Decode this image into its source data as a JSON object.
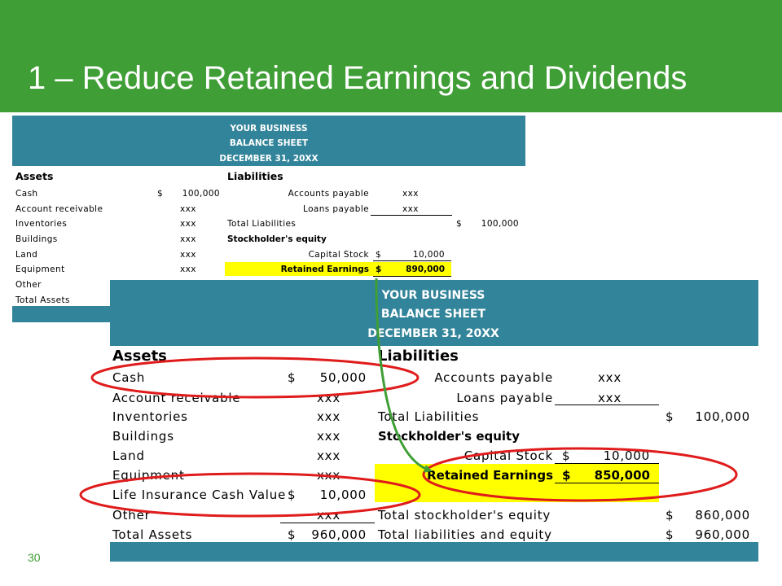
{
  "slide": {
    "title": "1 – Reduce Retained Earnings and Dividends",
    "number": "30"
  },
  "before_sheet": {
    "header": [
      "YOUR BUSINESS",
      "BALANCE SHEET",
      "DECEMBER 31, 20XX"
    ],
    "assets_heading": "Assets",
    "liabilities_heading": "Liabilities",
    "dollar": "$",
    "assets": [
      {
        "label": "Cash",
        "amount": "100,000"
      },
      {
        "label": "Account receivable",
        "amount": "xxx"
      },
      {
        "label": "Inventories",
        "amount": "xxx"
      },
      {
        "label": "Buildings",
        "amount": "xxx"
      },
      {
        "label": "Land",
        "amount": "xxx"
      },
      {
        "label": "Equipment",
        "amount": "xxx"
      },
      {
        "label": "Other",
        "amount": ""
      },
      {
        "label": "Total Assets",
        "amount": ""
      }
    ],
    "accounts_payable": {
      "label": "Accounts payable",
      "amount": "xxx"
    },
    "loans_payable": {
      "label": "Loans payable",
      "amount": "xxx"
    },
    "total_liabilities": {
      "label": "Total Liabilities",
      "amount": "100,000"
    },
    "stockholders_equity": "Stockholder's equity",
    "capital_stock": {
      "label": "Capital Stock",
      "amount": "10,000"
    },
    "retained_earnings": {
      "label": "Retained Earnings",
      "amount": "890,000"
    }
  },
  "after_sheet": {
    "header": [
      "YOUR BUSINESS",
      "BALANCE SHEET",
      "DECEMBER 31, 20XX"
    ],
    "assets_heading": "Assets",
    "liabilities_heading": "Liabilities",
    "dollar": "$",
    "cash": {
      "label": "Cash",
      "amount": "50,000"
    },
    "account_receivable": {
      "label": "Account receivable",
      "amount": "xxx"
    },
    "inventories": {
      "label": "Inventories",
      "amount": "xxx"
    },
    "buildings": {
      "label": "Buildings",
      "amount": "xxx"
    },
    "land": {
      "label": "Land",
      "amount": "xxx"
    },
    "equipment": {
      "label": "Equipment",
      "amount": "xxx"
    },
    "life_insurance": {
      "label": "Life Insurance Cash Value",
      "amount": "10,000"
    },
    "other": {
      "label": "Other",
      "amount": "xxx"
    },
    "total_assets": {
      "label": "Total Assets",
      "amount": "960,000"
    },
    "accounts_payable": {
      "label": "Accounts payable",
      "amount": "xxx"
    },
    "loans_payable": {
      "label": "Loans payable",
      "amount": "xxx"
    },
    "total_liabilities": {
      "label": "Total Liabilities",
      "amount": "100,000"
    },
    "stockholders_equity": "Stockholder's equity",
    "capital_stock": {
      "label": "Capital Stock",
      "amount": "10,000"
    },
    "retained_earnings": {
      "label": "Retained Earnings",
      "amount": "850,000"
    },
    "total_stockholders_equity": {
      "label": "Total stockholder's equity",
      "amount": "860,000"
    },
    "total_liabilities_equity": {
      "label": "Total liabilities and equity",
      "amount": "960,000"
    }
  },
  "annotations": {
    "circle_color": "#e01b1b",
    "arrow_color": "#3f9e35"
  }
}
